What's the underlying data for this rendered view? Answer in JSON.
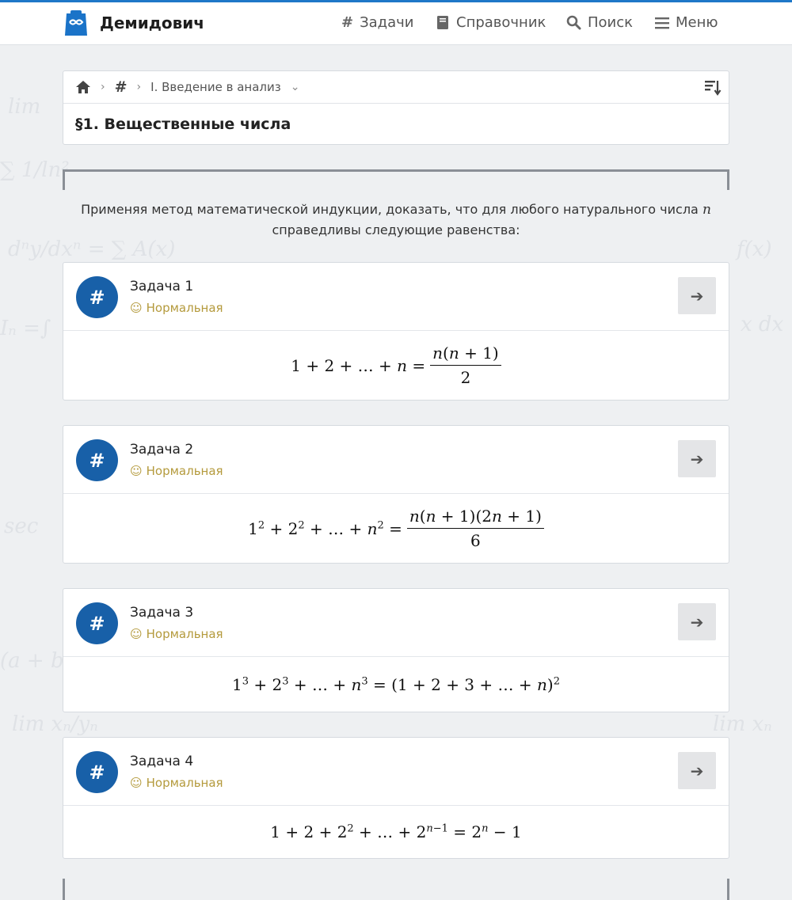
{
  "header": {
    "brand": "Демидович",
    "nav": [
      {
        "icon": "hash-icon",
        "label": "Задачи"
      },
      {
        "icon": "book-icon",
        "label": "Справочник"
      },
      {
        "icon": "search-icon",
        "label": "Поиск"
      },
      {
        "icon": "menu-icon",
        "label": "Меню"
      }
    ]
  },
  "breadcrumb": {
    "current": "I. Введение в анализ"
  },
  "section": {
    "title": "§1. Вещественные числа"
  },
  "intro": {
    "text_before": "Применяя метод математической индукции, доказать, что для любого натурального числа ",
    "variable": "n",
    "text_after": "справедливы следующие равенства:"
  },
  "tasks": [
    {
      "title": "Задача 1",
      "level": "Нормальная",
      "formula": "1 + 2 + … + n = n(n + 1) / 2"
    },
    {
      "title": "Задача 2",
      "level": "Нормальная",
      "formula": "1² + 2² + … + n² = n(n + 1)(2n + 1) / 6"
    },
    {
      "title": "Задача 3",
      "level": "Нормальная",
      "formula": "1³ + 2³ + … + n³ = (1 + 2 + 3 + … + n)²"
    },
    {
      "title": "Задача 4",
      "level": "Нормальная",
      "formula": "1 + 2 + 2² + … + 2ⁿ⁻¹ = 2ⁿ − 1"
    }
  ],
  "colors": {
    "accent": "#1860a8",
    "level": "#b49a3c",
    "background": "#eef0f2"
  }
}
